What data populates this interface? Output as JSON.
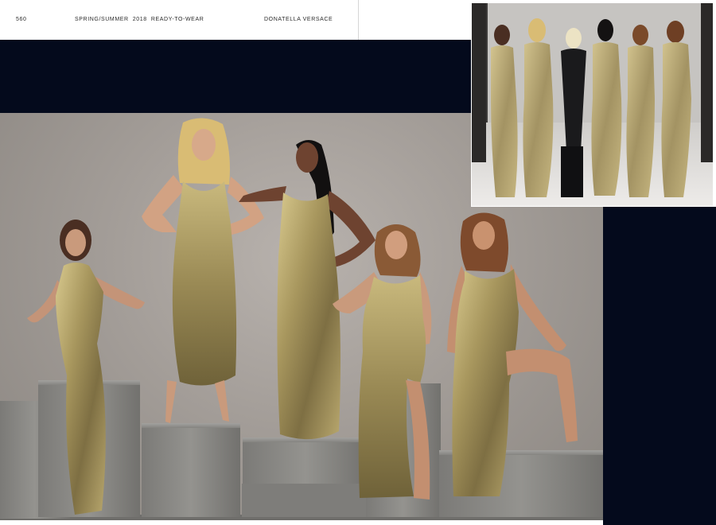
{
  "header": {
    "page_number": "560",
    "section": "SPRING/SUMMER  2018  READY-TO-WEAR",
    "designer": "DONATELLA VERSACE"
  },
  "colors": {
    "navy": "#040a1c",
    "backdrop": "#a39d98",
    "gold_dress": "#a8975e",
    "plinth": "#8d8c89",
    "runway_floor": "#e4e2e0"
  },
  "photos": {
    "main": {
      "figures": 5,
      "subject": "five-models-gold-chainmail-gowns-on-plinths"
    },
    "inset": {
      "figures": 6,
      "subject": "runway-finale-line-up"
    }
  }
}
